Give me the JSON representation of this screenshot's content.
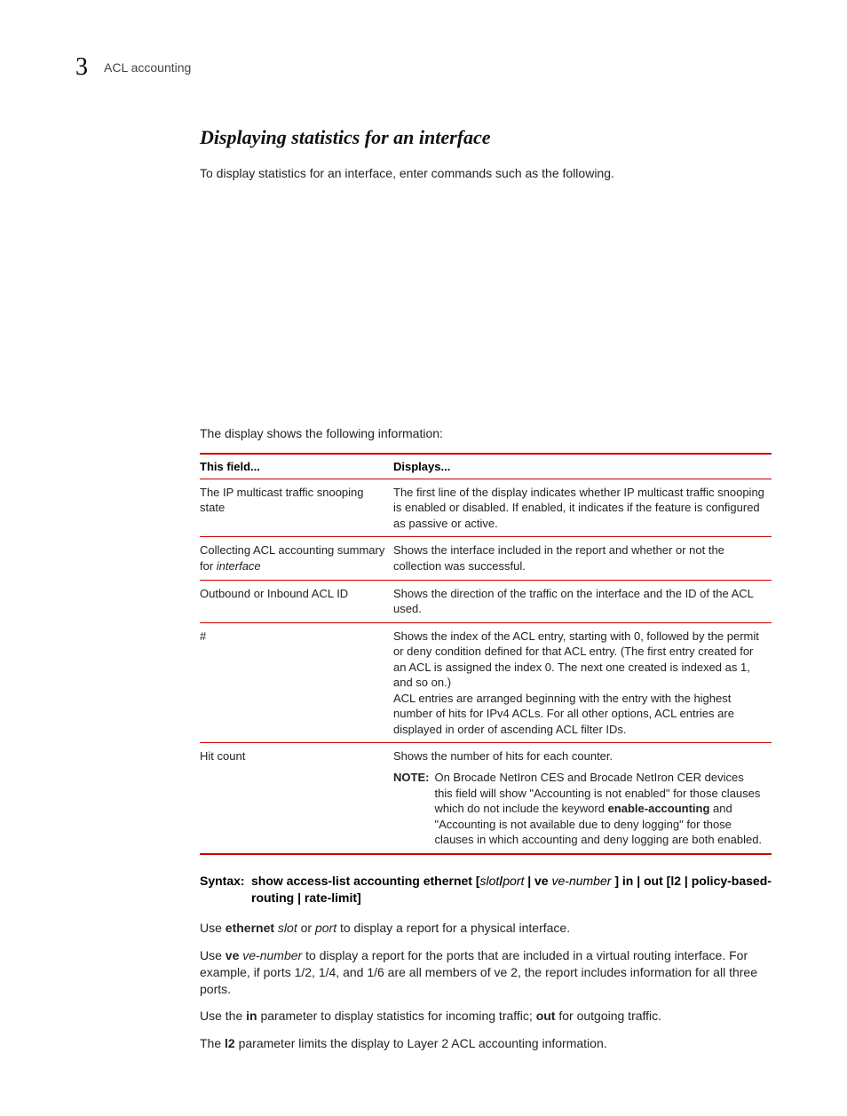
{
  "header": {
    "chapter": "3",
    "title": "ACL accounting"
  },
  "section": {
    "title": "Displaying statistics for an interface",
    "intro": "To display statistics for an interface, enter commands such as the following.",
    "after_block": "The display shows the following information:"
  },
  "table": {
    "head_field": "This field...",
    "head_displays": "Displays...",
    "rows": [
      {
        "field": "The IP multicast traffic snooping state",
        "displays": "The first line of the display indicates whether IP multicast traffic snooping is enabled or disabled. If enabled, it indicates if the feature is configured as passive or active."
      },
      {
        "field_pre": "Collecting ACL accounting summary for ",
        "field_ital": "interface",
        "displays": "Shows the interface included in the report and whether or not the collection was successful."
      },
      {
        "field": "Outbound or Inbound ACL ID",
        "displays": "Shows the direction of the traffic on the interface and the ID of the ACL used."
      },
      {
        "field": "#",
        "displays_p1": "Shows the index of the ACL entry, starting with 0, followed by the permit or deny condition defined for that ACL entry. (The first entry created for an ACL is assigned the index 0. The next one created is indexed as 1, and so on.)",
        "displays_p2": "ACL entries are arranged beginning with the entry with the highest number of hits for IPv4 ACLs. For all other options, ACL entries are displayed in order of ascending ACL filter IDs."
      },
      {
        "field": "Hit count",
        "displays_main": "Shows the number of hits for each counter.",
        "note_label": "NOTE:",
        "note_pre": "On Brocade NetIron CES and Brocade NetIron CER devices this field will show \"Accounting is not enabled\" for those clauses which do not include the keyword ",
        "note_bold": "enable-accounting",
        "note_post": " and \"Accounting is not available due to deny logging\" for those clauses in which accounting and deny logging are both enabled."
      }
    ]
  },
  "syntax": {
    "label": "Syntax:",
    "part_bold1": "show access-list accounting ethernet [",
    "part_ital1": "slot",
    "part_bold2": "/",
    "part_ital2": "port ",
    "part_bold3": "| ve ",
    "part_ital3": "ve-number ",
    "part_bold4": "]   in | out [l2 | policy-based-routing | rate-limit]"
  },
  "paras": {
    "p1_pre": "Use ",
    "p1_bold": "ethernet ",
    "p1_ital1": "slot",
    "p1_mid": " or ",
    "p1_ital2": "port",
    "p1_post": " to display a report for a physical interface.",
    "p2_pre": "Use ",
    "p2_bold": "ve ",
    "p2_ital": "ve-number",
    "p2_post": " to display a report for the ports that are included in a virtual routing interface. For example, if ports 1/2, 1/4, and 1/6 are all members of ve 2, the report includes information for all three ports.",
    "p3_pre": "Use the ",
    "p3_bold1": "in",
    "p3_mid": " parameter to display statistics for incoming traffic; ",
    "p3_bold2": "out",
    "p3_post": " for outgoing traffic.",
    "p4_pre": "The ",
    "p4_bold": "l2",
    "p4_post": " parameter limits the display to Layer 2 ACL accounting information."
  }
}
